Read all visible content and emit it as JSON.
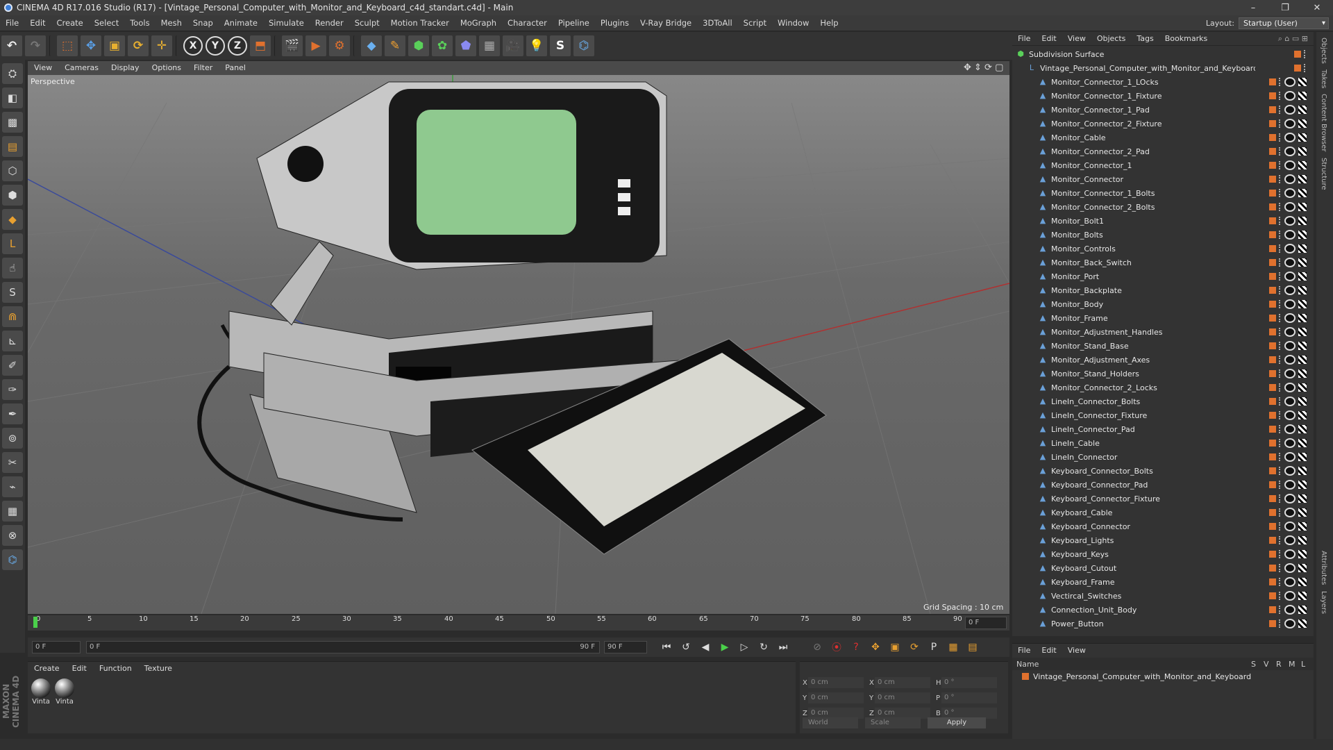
{
  "title": "CINEMA 4D R17.016 Studio (R17) - [Vintage_Personal_Computer_with_Monitor_and_Keyboard_c4d_standart.c4d] - Main",
  "menus": [
    "File",
    "Edit",
    "Create",
    "Select",
    "Tools",
    "Mesh",
    "Snap",
    "Animate",
    "Simulate",
    "Render",
    "Sculpt",
    "Motion Tracker",
    "MoGraph",
    "Character",
    "Pipeline",
    "Plugins",
    "V-Ray Bridge",
    "3DToAll",
    "Script",
    "Window",
    "Help"
  ],
  "layout": {
    "label": "Layout:",
    "value": "Startup (User)"
  },
  "viewport": {
    "menus": [
      "View",
      "Cameras",
      "Display",
      "Options",
      "Filter",
      "Panel"
    ],
    "label": "Perspective",
    "grid_spacing": "Grid Spacing : 10 cm"
  },
  "timeline": {
    "ticks": [
      "0",
      "5",
      "10",
      "15",
      "20",
      "25",
      "30",
      "35",
      "40",
      "45",
      "50",
      "55",
      "60",
      "65",
      "70",
      "75",
      "80",
      "85",
      "90"
    ],
    "current_frame": "0 F",
    "start_field": "0 F",
    "range_start": "0 F",
    "range_end": "90 F",
    "end_field": "90 F"
  },
  "materials": {
    "menus": [
      "Create",
      "Edit",
      "Function",
      "Texture"
    ],
    "items": [
      {
        "label": "Vinta"
      },
      {
        "label": "Vinta"
      }
    ]
  },
  "coords": {
    "rows": [
      {
        "a": "X",
        "v1": "0 cm",
        "b": "X",
        "v2": "0 cm",
        "c": "H",
        "v3": "0 °"
      },
      {
        "a": "Y",
        "v1": "0 cm",
        "b": "Y",
        "v2": "0 cm",
        "c": "P",
        "v3": "0 °"
      },
      {
        "a": "Z",
        "v1": "0 cm",
        "b": "Z",
        "v2": "0 cm",
        "c": "B",
        "v3": "0 °"
      }
    ],
    "world": "World",
    "scale": "Scale",
    "apply": "Apply"
  },
  "objects": {
    "menus": [
      "File",
      "Edit",
      "View",
      "Objects",
      "Tags",
      "Bookmarks"
    ],
    "root": "Subdivision Surface",
    "group": "Vintage_Personal_Computer_with_Monitor_and_Keyboard",
    "items": [
      "Monitor_Connector_1_LOcks",
      "Monitor_Connector_1_Fixture",
      "Monitor_Connector_1_Pad",
      "Monitor_Connector_2_Fixture",
      "Monitor_Cable",
      "Monitor_Connector_2_Pad",
      "Monitor_Connector_1",
      "Monitor_Connector",
      "Monitor_Connector_1_Bolts",
      "Monitor_Connector_2_Bolts",
      "Monitor_Bolt1",
      "Monitor_Bolts",
      "Monitor_Controls",
      "Monitor_Back_Switch",
      "Monitor_Port",
      "Monitor_Backplate",
      "Monitor_Body",
      "Monitor_Frame",
      "Monitor_Adjustment_Handles",
      "Monitor_Stand_Base",
      "Monitor_Adjustment_Axes",
      "Monitor_Stand_Holders",
      "Monitor_Connector_2_Locks",
      "LineIn_Connector_Bolts",
      "LineIn_Connector_Fixture",
      "LineIn_Connector_Pad",
      "LineIn_Cable",
      "LineIn_Connector",
      "Keyboard_Connector_Bolts",
      "Keyboard_Connector_Pad",
      "Keyboard_Connector_Fixture",
      "Keyboard_Cable",
      "Keyboard_Connector",
      "Keyboard_Lights",
      "Keyboard_Keys",
      "Keyboard_Cutout",
      "Keyboard_Frame",
      "Vectircal_Switches",
      "Connection_Unit_Body",
      "Power_Button"
    ]
  },
  "layers": {
    "menus": [
      "File",
      "Edit",
      "View"
    ],
    "headers": {
      "name": "Name",
      "cols": [
        "S",
        "V",
        "R",
        "M",
        "L"
      ]
    },
    "row": "Vintage_Personal_Computer_with_Monitor_and_Keyboard"
  },
  "sidetabs": [
    "Objects",
    "Takes",
    "Content Browser",
    "Structure",
    "Attributes",
    "Layers"
  ],
  "brand": "MAXON CINEMA 4D",
  "colors": {
    "accent": "#e0712e",
    "screen": "#8fc98f",
    "bg": "#333333"
  }
}
